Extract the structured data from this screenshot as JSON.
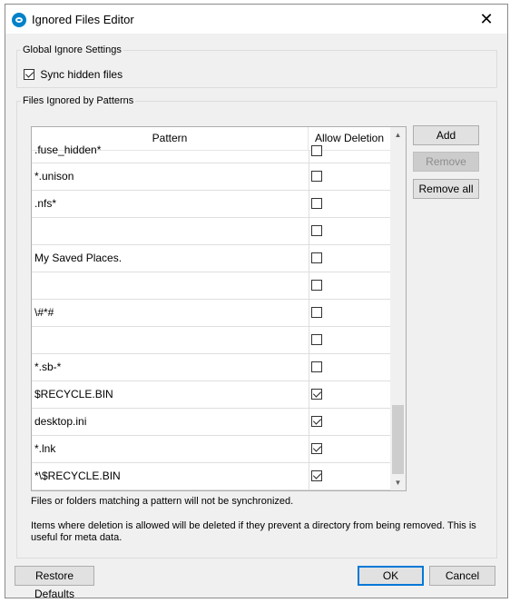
{
  "window": {
    "title": "Ignored Files Editor",
    "close_glyph": "✕"
  },
  "global": {
    "group_label": "Global Ignore Settings",
    "sync_hidden_label": "Sync hidden files",
    "sync_hidden_checked": true
  },
  "patterns": {
    "group_label": "Files Ignored by Patterns",
    "columns": [
      "Pattern",
      "Allow Deletion"
    ],
    "rows": [
      {
        "pattern": ".fuse_hidden*",
        "allow": false
      },
      {
        "pattern": "*.unison",
        "allow": false
      },
      {
        "pattern": ".nfs*",
        "allow": false
      },
      {
        "pattern": "",
        "allow": false
      },
      {
        "pattern": "My Saved Places.",
        "allow": false
      },
      {
        "pattern": "",
        "allow": false
      },
      {
        "pattern": "\\#*#",
        "allow": false
      },
      {
        "pattern": "",
        "allow": false
      },
      {
        "pattern": "*.sb-*",
        "allow": false
      },
      {
        "pattern": "$RECYCLE.BIN",
        "allow": true
      },
      {
        "pattern": "desktop.ini",
        "allow": true
      },
      {
        "pattern": "*.lnk",
        "allow": true
      },
      {
        "pattern": "*\\$RECYCLE.BIN",
        "allow": true
      }
    ],
    "buttons": {
      "add": "Add",
      "remove": "Remove",
      "remove_all": "Remove all"
    },
    "info_1": "Files or folders matching a pattern will not be synchronized.",
    "info_2_line1": "Items where deletion is allowed will be deleted if they prevent a directory from being removed. This is",
    "info_2_line2": "useful for meta data."
  },
  "footer": {
    "restore_defaults": "Restore Defaults",
    "ok": "OK",
    "cancel": "Cancel"
  },
  "colors": {
    "accent": "#0078d7",
    "app_icon": "#0082c9"
  }
}
